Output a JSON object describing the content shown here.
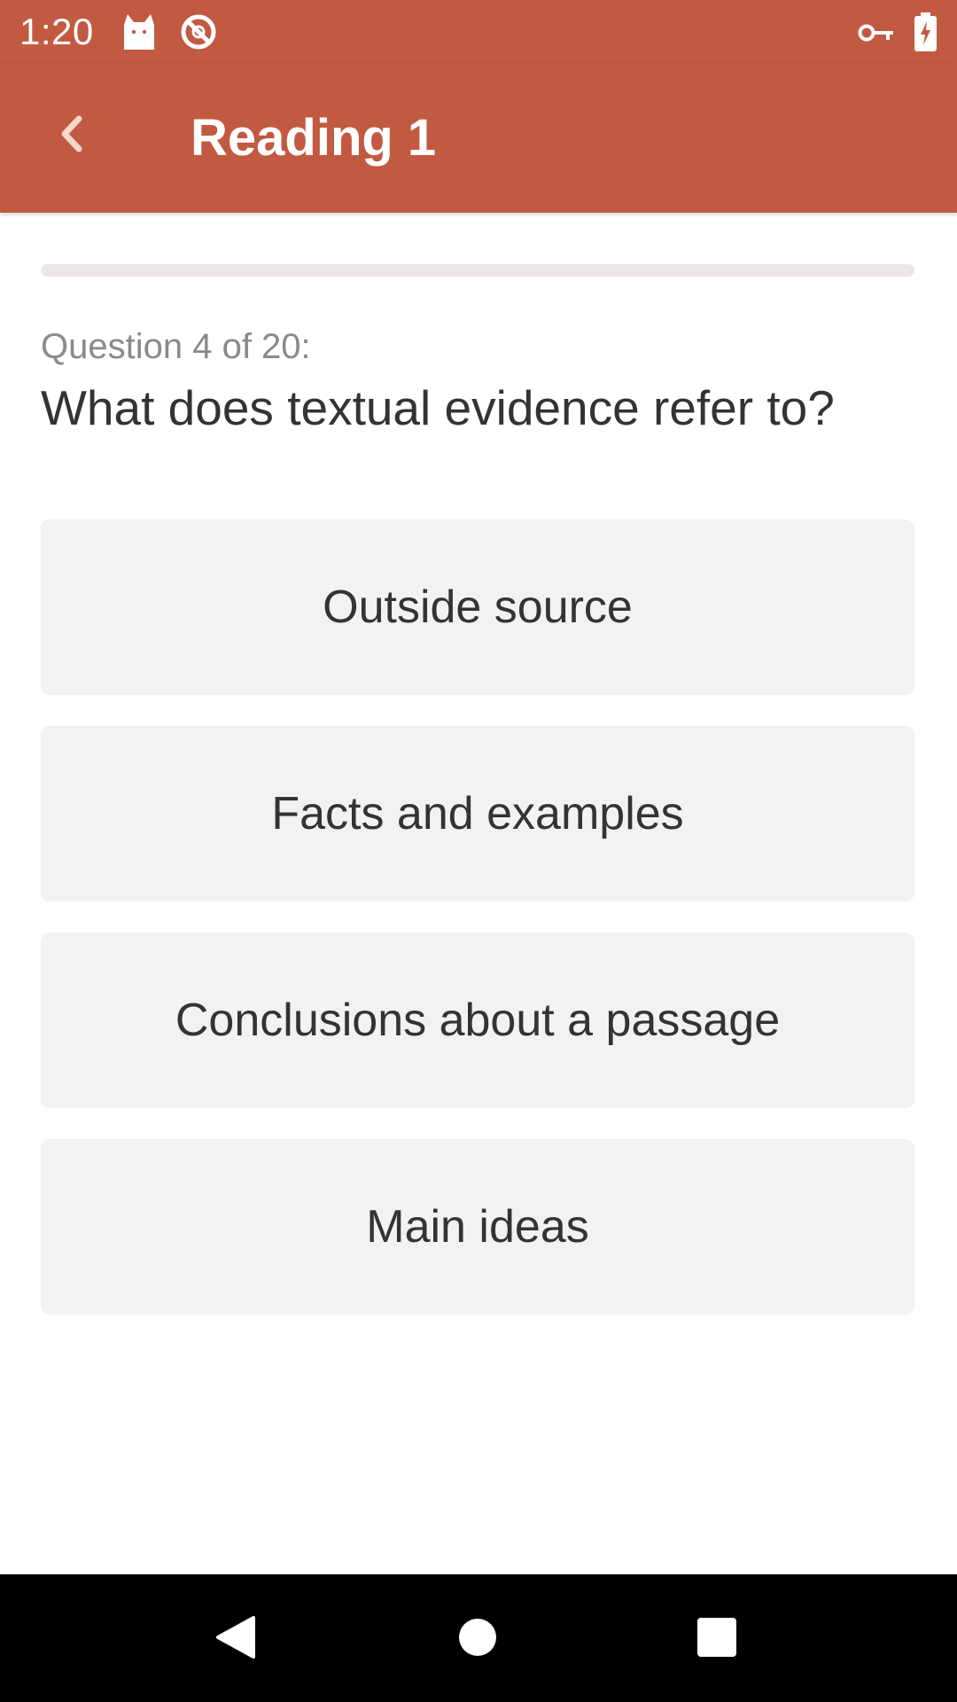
{
  "status_bar": {
    "time": "1:20",
    "icons": [
      "cat-notification-icon",
      "blocked-icon",
      "vpn-key-icon",
      "battery-charging-icon"
    ]
  },
  "app_bar": {
    "back_icon": "chevron-left-icon",
    "title": "Reading 1"
  },
  "quiz": {
    "progress_fraction": 0,
    "question_counter": "Question 4 of 20:",
    "question": "What does textual evidence refer to?",
    "answers": [
      "Outside source",
      "Facts and examples",
      "Conclusions about a passage",
      "Main ideas"
    ]
  },
  "nav_bar": {
    "icons": [
      "back-triangle-icon",
      "home-circle-icon",
      "recents-square-icon"
    ]
  },
  "colors": {
    "primary": "#c15a41",
    "answer_background": "#f2f2f2",
    "progress_track": "#ece6e7",
    "text_dark": "#333333",
    "text_muted": "#8a8a8a"
  }
}
